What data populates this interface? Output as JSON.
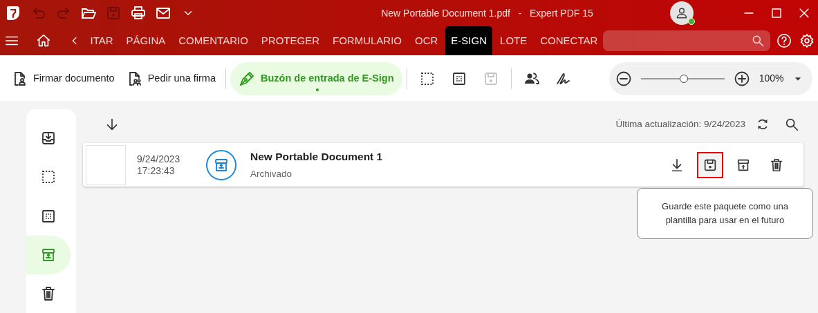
{
  "window": {
    "title": "New Portable Document 1.pdf   -   Expert PDF 15"
  },
  "quick_access": [
    {
      "kind": "undo",
      "disabled": true
    },
    {
      "kind": "redo",
      "disabled": true
    },
    {
      "kind": "open",
      "disabled": false
    },
    {
      "kind": "save",
      "disabled": true
    },
    {
      "kind": "print",
      "disabled": false
    },
    {
      "kind": "mail",
      "disabled": false
    },
    {
      "kind": "more",
      "disabled": false
    }
  ],
  "ribbon_tabs": [
    {
      "label": "ITAR",
      "selected": false
    },
    {
      "label": "PÁGINA",
      "selected": false
    },
    {
      "label": "COMENTARIO",
      "selected": false
    },
    {
      "label": "PROTEGER",
      "selected": false
    },
    {
      "label": "FORMULARIO",
      "selected": false
    },
    {
      "label": "OCR",
      "selected": false
    },
    {
      "label": "E-SIGN",
      "selected": true
    },
    {
      "label": "LOTE",
      "selected": false
    },
    {
      "label": "CONECTAR",
      "selected": false
    }
  ],
  "toolbar": [
    {
      "kind": "sign",
      "label": "Firmar documento",
      "selected": false,
      "disabled": false
    },
    {
      "kind": "request",
      "label": "Pedir una firma",
      "selected": false,
      "disabled": false
    },
    {
      "kind": "separator"
    },
    {
      "kind": "pen",
      "label": "Buzón de entrada de E-Sign",
      "selected": true,
      "disabled": false
    },
    {
      "kind": "separator"
    },
    {
      "kind": "dotted",
      "disabled": false
    },
    {
      "kind": "grid",
      "disabled": false
    },
    {
      "kind": "save",
      "disabled": true
    },
    {
      "kind": "separator"
    },
    {
      "kind": "people",
      "disabled": false
    },
    {
      "kind": "signature",
      "disabled": false
    }
  ],
  "zoom": {
    "level": 0.5,
    "reading": "100%"
  },
  "sidebar": {
    "items": [
      {
        "kind": "inbox",
        "selected": false
      },
      {
        "kind": "dotted",
        "selected": false
      },
      {
        "kind": "grid",
        "selected": false
      },
      {
        "kind": "archive",
        "selected": true
      },
      {
        "kind": "trash",
        "selected": false
      }
    ]
  },
  "list_header": {
    "last_update": "Última actualización: 9/24/2023"
  },
  "documents": [
    {
      "date": "9/24/2023",
      "time": "17:23:43",
      "title": "New Portable Document 1",
      "status": "Archivado",
      "actions": [
        {
          "kind": "download",
          "highlighted": false
        },
        {
          "kind": "save",
          "highlighted": true
        },
        {
          "kind": "unarchive",
          "highlighted": false
        },
        {
          "kind": "trash",
          "highlighted": false
        }
      ]
    }
  ],
  "tooltip": {
    "text": "Guarde este paquete como una plantilla para usar en el futuro"
  }
}
